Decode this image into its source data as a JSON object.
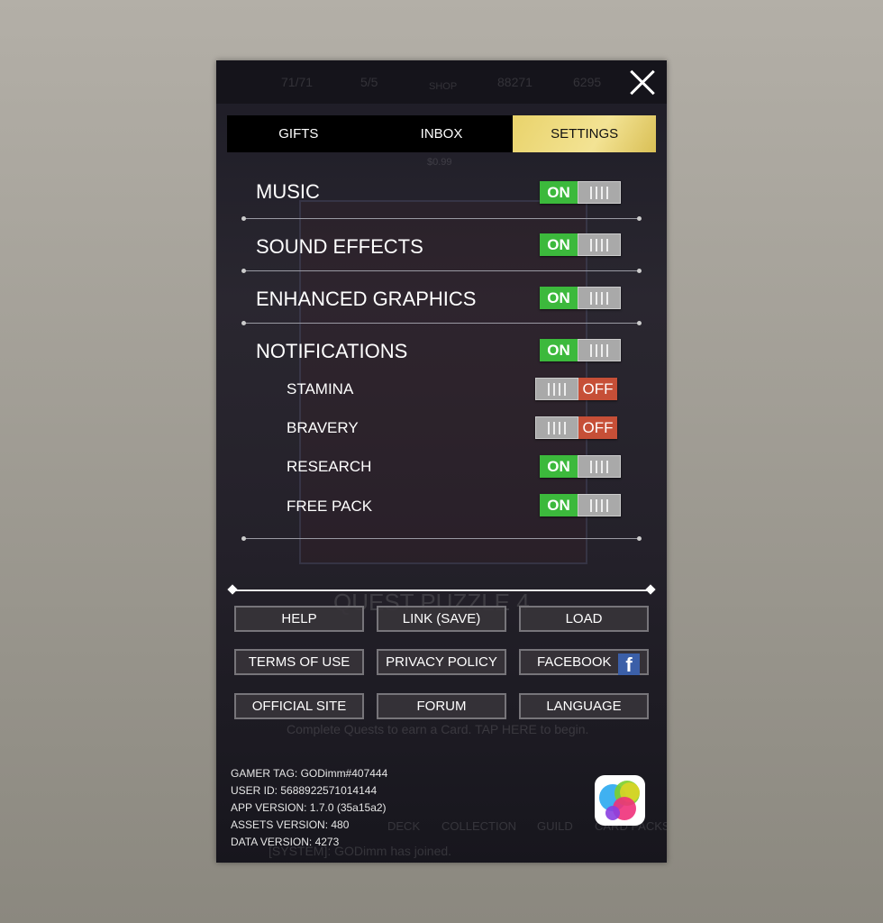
{
  "background": {
    "stamina": "71/71",
    "bravery": "5/5",
    "shop": "SHOP",
    "gold": "88271",
    "gems": "6295",
    "price": "$0.99",
    "quest_title": "QUEST PUZZLE 4",
    "quest_hint": "Complete Quests to earn a Card. TAP HERE to begin.",
    "nav": [
      "DECK",
      "COLLECTION",
      "GUILD",
      "CARD PACKS"
    ],
    "chat": "[SYSTEM]:  GODimm has joined."
  },
  "tabs": [
    {
      "label": "GIFTS",
      "active": false
    },
    {
      "label": "INBOX",
      "active": false
    },
    {
      "label": "SETTINGS",
      "active": true
    }
  ],
  "settings": [
    {
      "label": "MUSIC",
      "state": "ON"
    },
    {
      "label": "SOUND EFFECTS",
      "state": "ON"
    },
    {
      "label": "ENHANCED GRAPHICS",
      "state": "ON"
    },
    {
      "label": "NOTIFICATIONS",
      "state": "ON"
    }
  ],
  "notifications": [
    {
      "label": "STAMINA",
      "state": "OFF"
    },
    {
      "label": "BRAVERY",
      "state": "OFF"
    },
    {
      "label": "RESEARCH",
      "state": "ON"
    },
    {
      "label": "FREE PACK",
      "state": "ON"
    }
  ],
  "buttons": [
    "HELP",
    "LINK (SAVE)",
    "LOAD",
    "TERMS OF USE",
    "PRIVACY POLICY",
    "FACEBOOK",
    "OFFICIAL SITE",
    "FORUM",
    "LANGUAGE"
  ],
  "facebook_glyph": "f",
  "info": [
    "GAMER TAG: GODimm#407444",
    "USER ID: 5688922571014144",
    "APP VERSION: 1.7.0 (35a15a2)",
    "ASSETS VERSION: 480",
    "DATA VERSION: 4273"
  ],
  "colors": {
    "on": "#3cb93c",
    "off": "#c64f37",
    "active_tab": "#f3e394"
  }
}
